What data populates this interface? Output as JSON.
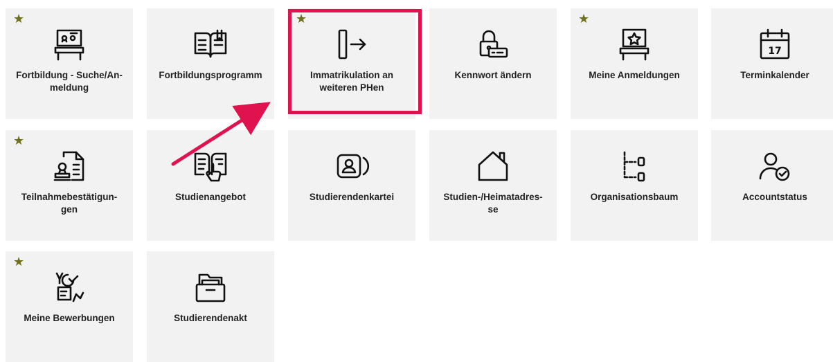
{
  "tiles": [
    {
      "label": "Fortbildung - Suche/An-\nmeldung",
      "icon": "classroom-board-icon",
      "starred": true
    },
    {
      "label": "Fortbildungsprogramm",
      "icon": "open-book-icon",
      "starred": false
    },
    {
      "label": "Immatrikulation an\nweiteren PHen",
      "icon": "door-exit-arrow-icon",
      "starred": true
    },
    {
      "label": "Kennwort ändern",
      "icon": "lock-password-icon",
      "starred": false
    },
    {
      "label": "Meine Anmeldungen",
      "icon": "star-board-icon",
      "starred": true
    },
    {
      "label": "Terminkalender",
      "icon": "calendar-icon",
      "starred": false
    },
    {
      "label": "Teilnahmebestätigun-\ngen",
      "icon": "certificate-stamp-icon",
      "starred": true
    },
    {
      "label": "Studienangebot",
      "icon": "book-hand-icon",
      "starred": false
    },
    {
      "label": "Studierendenkartei",
      "icon": "contact-card-icon",
      "starred": false
    },
    {
      "label": "Studien-/Heimatadres-\nse",
      "icon": "house-icon",
      "starred": false
    },
    {
      "label": "Organisationsbaum",
      "icon": "org-tree-icon",
      "starred": false
    },
    {
      "label": "Accountstatus",
      "icon": "user-check-icon",
      "starred": false
    },
    {
      "label": "Meine Bewerbungen",
      "icon": "application-person-icon",
      "starred": true
    },
    {
      "label": "Studierendenakt",
      "icon": "file-drawer-icon",
      "starred": false
    }
  ],
  "star_glyph": "★",
  "colors": {
    "tile_bg": "#f2f2f2",
    "star": "#6f6f1e",
    "highlight": "#e0134f",
    "arrow": "#e0134f"
  }
}
